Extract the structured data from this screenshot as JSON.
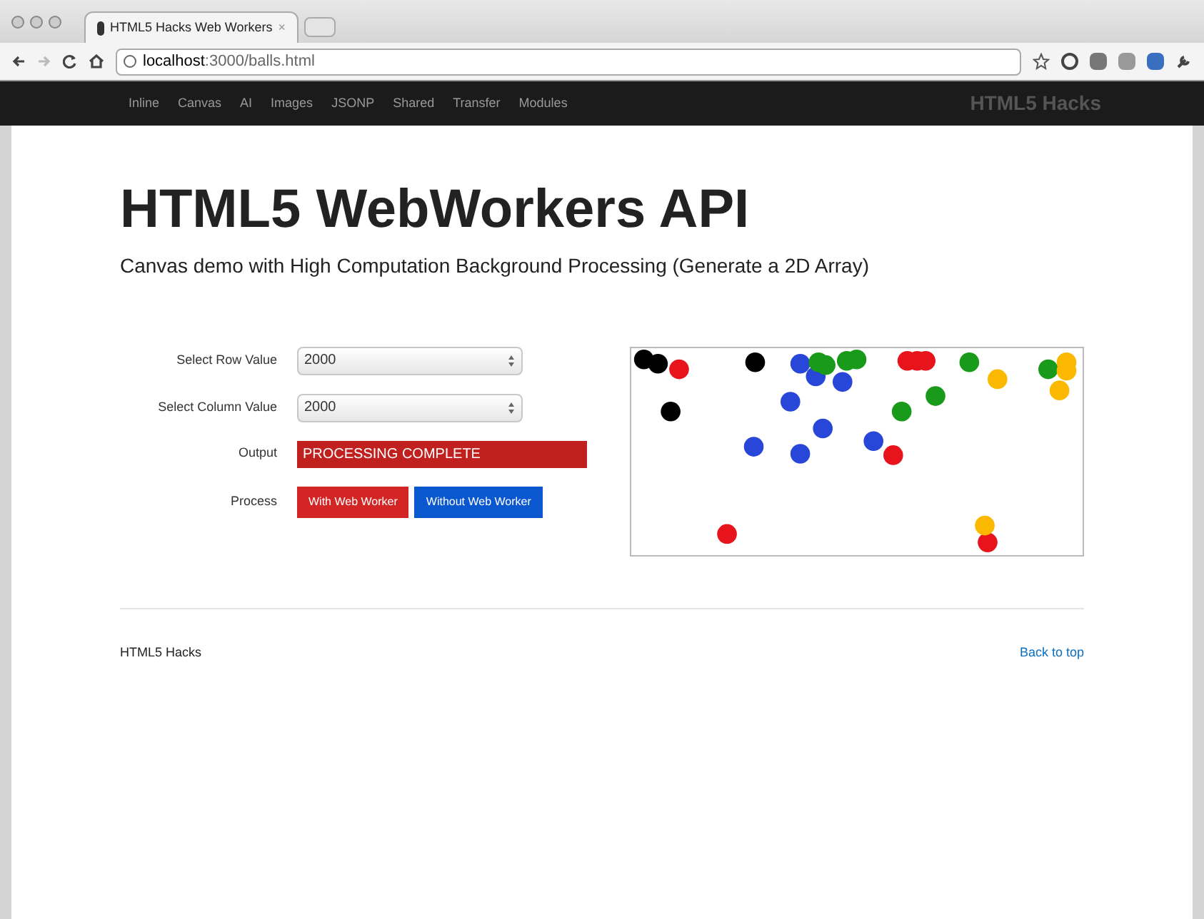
{
  "browser": {
    "tab_title": "HTML5 Hacks Web Workers",
    "tab_close": "×",
    "url_host": "localhost",
    "url_path": ":3000/balls.html"
  },
  "navbar": {
    "links": [
      {
        "label": "Inline"
      },
      {
        "label": "Canvas"
      },
      {
        "label": "AI"
      },
      {
        "label": "Images"
      },
      {
        "label": "JSONP"
      },
      {
        "label": "Shared"
      },
      {
        "label": "Transfer"
      },
      {
        "label": "Modules"
      }
    ],
    "brand": "HTML5 Hacks"
  },
  "header": {
    "title": "HTML5 WebWorkers API",
    "subtitle": "Canvas demo with High Computation Background Processing (Generate a 2D Array)"
  },
  "form": {
    "row_label": "Select Row Value",
    "row_value": "2000",
    "column_label": "Select Column Value",
    "column_value": "2000",
    "output_label": "Output",
    "output_value": "PROCESSING COMPLETE",
    "process_label": "Process",
    "buttons": [
      "With Web Worker",
      "Without Web Worker"
    ]
  },
  "footer": {
    "text": "HTML5 Hacks",
    "link": "Back to top"
  }
}
